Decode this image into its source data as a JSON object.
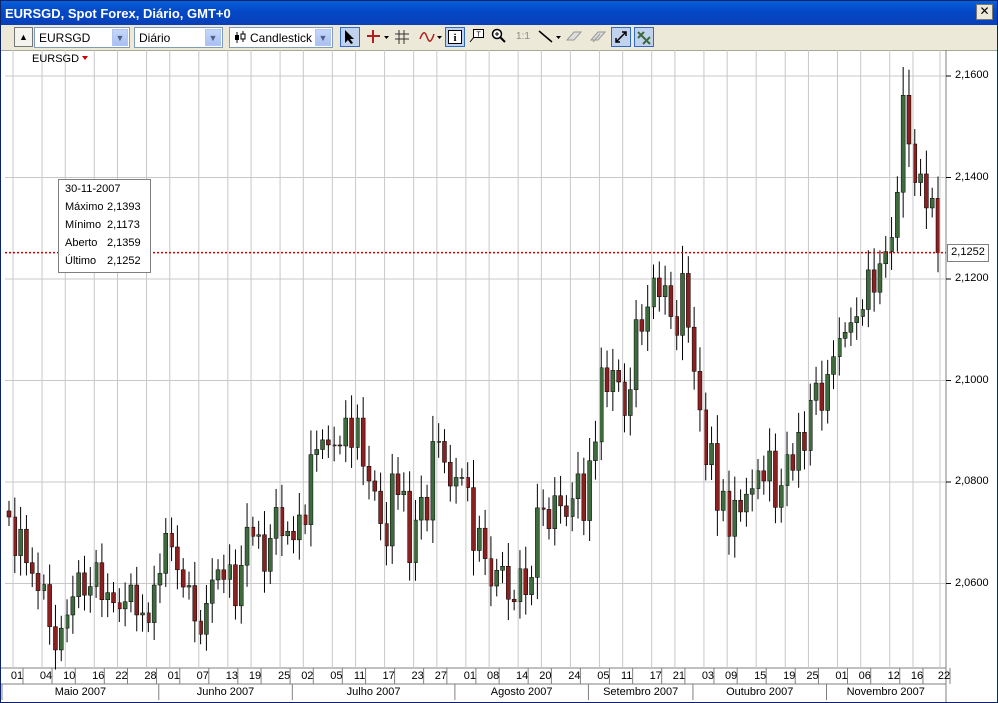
{
  "window": {
    "title": "EURSGD, Spot Forex, Diário, GMT+0",
    "close_glyph": "✕"
  },
  "toolbar": {
    "symbol": "EURSGD",
    "period": "Diário",
    "chart_type": "Candlestick",
    "zoom_1to1_label": "1:1",
    "icons": [
      "collapse-up-icon",
      "cursor-pointer-icon",
      "crosshair-icon",
      "grid-icon",
      "indicator-icon",
      "info-icon",
      "annotate-icon",
      "zoom-icon",
      "zoom-1to1-icon",
      "trendline-icon",
      "eraser-icon",
      "erase-all-icon",
      "autoscroll-icon",
      "autoscale-icon"
    ]
  },
  "chart": {
    "symbol_label": "EURSGD",
    "last_price_tag": "2,1252",
    "tooltip": {
      "date": "30-11-2007",
      "rows": [
        {
          "label": "Máximo",
          "value": "2,1393"
        },
        {
          "label": "Mínimo",
          "value": "2,1173"
        },
        {
          "label": "Aberto",
          "value": "2,1359"
        },
        {
          "label": "Último",
          "value": "2,1252"
        }
      ]
    },
    "colors": {
      "up": "#3d6b3d",
      "down": "#8b2020",
      "wick": "#000000",
      "grid": "#c8c8c8",
      "price_line": "#cc0000"
    }
  },
  "chart_data": {
    "type": "candlestick",
    "title": "EURSGD, Spot Forex, Diário, GMT+0",
    "y_ticks": [
      "2,1600",
      "2,1400",
      "2,1200",
      "2,1000",
      "2,0800",
      "2,0600"
    ],
    "y_tick_values": [
      2.16,
      2.14,
      2.12,
      2.1,
      2.08,
      2.06
    ],
    "ylim": [
      2.0415,
      2.1645
    ],
    "x_day_ticks": [
      "01",
      "04",
      "10",
      "16",
      "22",
      "28",
      "01",
      "07",
      "13",
      "19",
      "25",
      "02",
      "05",
      "11",
      "17",
      "23",
      "27",
      "01",
      "08",
      "14",
      "20",
      "24",
      "05",
      "11",
      "17",
      "21",
      "03",
      "09",
      "15",
      "19",
      "25",
      "01",
      "06",
      "12",
      "16",
      "22"
    ],
    "x_month_labels": [
      "Maio 2007",
      "Junho 2007",
      "Julho 2007",
      "Agosto 2007",
      "Setembro 2007",
      "Outubro 2007",
      "Novembro 2007"
    ],
    "closes": [
      2.0731,
      2.0655,
      2.0707,
      2.0641,
      2.062,
      2.0586,
      2.0598,
      2.0515,
      2.0469,
      2.0512,
      2.0538,
      2.0574,
      2.0621,
      2.0577,
      2.0594,
      2.0641,
      2.0568,
      2.0582,
      2.0562,
      2.055,
      2.0564,
      2.0597,
      2.0538,
      2.0542,
      2.0523,
      2.0597,
      2.062,
      2.0699,
      2.0672,
      2.0627,
      2.0593,
      2.0596,
      2.0526,
      2.05,
      2.0561,
      2.0607,
      2.0627,
      2.0608,
      2.0637,
      2.0556,
      2.0636,
      2.0711,
      2.0693,
      2.0696,
      2.0624,
      2.0689,
      2.075,
      2.0694,
      2.0703,
      2.0686,
      2.0735,
      2.0716,
      2.0854,
      2.0864,
      2.0883,
      2.0873,
      2.0873,
      2.0871,
      2.0926,
      2.0868,
      2.0926,
      2.0831,
      2.0802,
      2.0782,
      2.0718,
      2.0674,
      2.0816,
      2.0775,
      2.0782,
      2.0641,
      2.0725,
      2.077,
      2.0725,
      2.088,
      2.088,
      2.0839,
      2.0792,
      2.0809,
      2.0809,
      2.0789,
      2.0665,
      2.0709,
      2.0649,
      2.0595,
      2.0626,
      2.0634,
      2.0569,
      2.0564,
      2.0629,
      2.0578,
      2.0612,
      2.0749,
      2.0746,
      2.0708,
      2.0773,
      2.0753,
      2.0732,
      2.0767,
      2.0816,
      2.0724,
      2.0842,
      2.0879,
      2.1025,
      2.0978,
      2.102,
      2.0997,
      2.0931,
      2.0982,
      2.112,
      2.1097,
      2.1145,
      2.1202,
      2.1165,
      2.1187,
      2.1126,
      2.1089,
      2.1211,
      2.1105,
      2.1018,
      2.0942,
      2.0834,
      2.0876,
      2.0744,
      2.0782,
      2.0693,
      2.0764,
      2.0741,
      2.0776,
      2.0787,
      2.0822,
      2.0802,
      2.0861,
      2.075,
      2.0793,
      2.0854,
      2.0823,
      2.0898,
      2.0862,
      2.0961,
      2.0995,
      2.0941,
      2.1012,
      2.1047,
      2.1083,
      2.1095,
      2.1114,
      2.1126,
      2.114,
      2.1218,
      2.1174,
      2.123,
      2.1254,
      2.1282,
      2.1371,
      2.1562,
      2.1466,
      2.139,
      2.1407,
      2.134,
      2.1359,
      2.1252
    ]
  }
}
